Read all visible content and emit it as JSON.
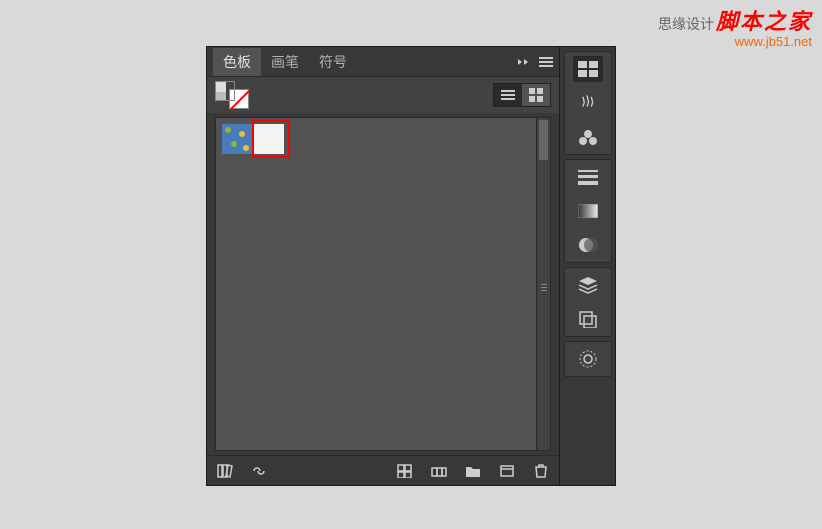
{
  "watermark": {
    "prefix": "思缘设计",
    "title": "脚本之家",
    "url": "www.jb51.net"
  },
  "tabs": {
    "items": [
      {
        "label": "色板",
        "active": true
      },
      {
        "label": "画笔",
        "active": false
      },
      {
        "label": "符号",
        "active": false
      }
    ]
  },
  "swatches": [
    {
      "id": "pattern-1"
    },
    {
      "id": "plain-light"
    }
  ]
}
